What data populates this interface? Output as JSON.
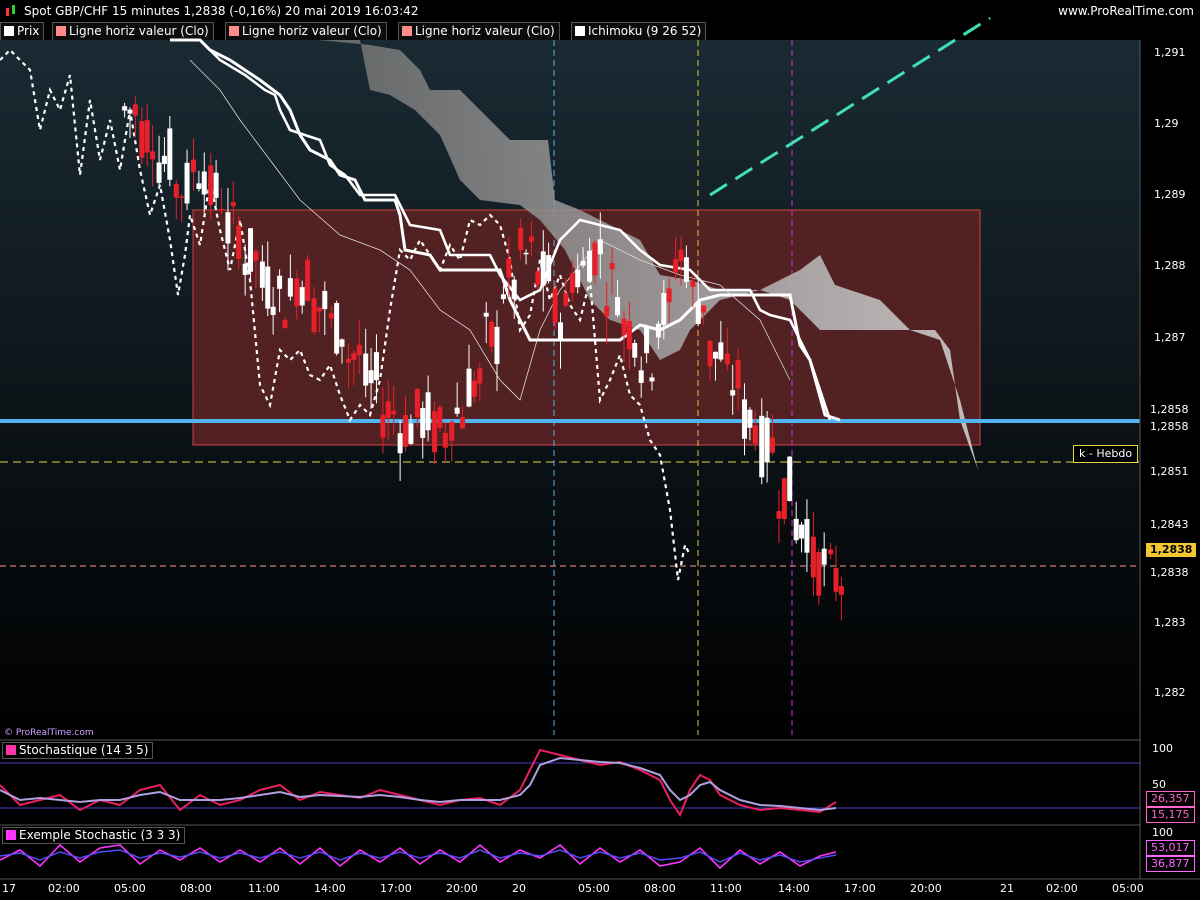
{
  "header": {
    "title": "Spot GBP/CHF 15 minutes 1,2838 (-0,16%) 20 mai 2019 16:03:42",
    "site": "www.ProRealTime.com"
  },
  "legend": [
    {
      "label": "Prix",
      "color": "#ffffff"
    },
    {
      "label": "Ligne horiz valeur (Clo)",
      "color": "#ff8b8b"
    },
    {
      "label": "Ligne horiz valeur (Clo)",
      "color": "#ff8b8b"
    },
    {
      "label": "Ligne horiz valeur (Clo)",
      "color": "#ff8b8b"
    },
    {
      "label": "Ichimoku (9 26 52)",
      "color": "#ffffff"
    }
  ],
  "credit": "© ProRealTime.com",
  "k_tag": "k - Hebdo",
  "price_axis": {
    "ticks": [
      "1,291",
      "1,29",
      "1,289",
      "1,288",
      "1,287",
      "1,2858",
      "1,2858",
      "1,2851",
      "1,2843",
      "1,2838",
      "1,2838",
      "1,283",
      "1,282"
    ],
    "current_price": "1,2838"
  },
  "stoch1": {
    "label": "Stochastique (14 3 5)",
    "color": "#ff33aa",
    "ticks": [
      "100",
      "50"
    ],
    "values": [
      "26,357",
      "15,175"
    ]
  },
  "stoch2": {
    "label": "Exemple Stochastic (3 3 3)",
    "color": "#ff33ff",
    "ticks": [
      "100"
    ],
    "values": [
      "53,017",
      "36,877"
    ]
  },
  "time_axis": [
    "17",
    "02:00",
    "05:00",
    "08:00",
    "11:00",
    "14:00",
    "17:00",
    "20:00",
    "20",
    "05:00",
    "08:00",
    "11:00",
    "14:00",
    "17:00",
    "20:00",
    "21",
    "02:00",
    "05:00"
  ],
  "colors": {
    "background": "#000000",
    "zone_fill": "#5a2224",
    "support_line": "#4fb4ef",
    "k_line": "#e8d448",
    "trend_line": "#3fe0b8",
    "candle_up": "#ffffff",
    "candle_down": "#e8202a"
  },
  "chart_data": {
    "type": "candlestick",
    "symbol": "Spot GBP/CHF",
    "timeframe": "15 minutes",
    "last": 1.2838,
    "change_pct": -0.16,
    "ylim": [
      1.2815,
      1.2915
    ],
    "support_level": 1.2858,
    "k_hebdo_level": 1.2851,
    "current_level": 1.2838,
    "zone": {
      "top": 1.2888,
      "bottom": 1.2855
    },
    "close_series": [
      1.2905,
      1.2902,
      1.2898,
      1.2894,
      1.2897,
      1.2893,
      1.2888,
      1.2884,
      1.288,
      1.2878,
      1.2881,
      1.2877,
      1.2874,
      1.287,
      1.2866,
      1.2862,
      1.286,
      1.2861,
      1.2859,
      1.2862,
      1.2866,
      1.2872,
      1.288,
      1.2884,
      1.2881,
      1.2876,
      1.2882,
      1.2885,
      1.288,
      1.2874,
      1.287,
      1.2876,
      1.2884,
      1.2878,
      1.287,
      1.2866,
      1.2861,
      1.2857,
      1.2851,
      1.2846,
      1.284,
      1.2838
    ]
  }
}
